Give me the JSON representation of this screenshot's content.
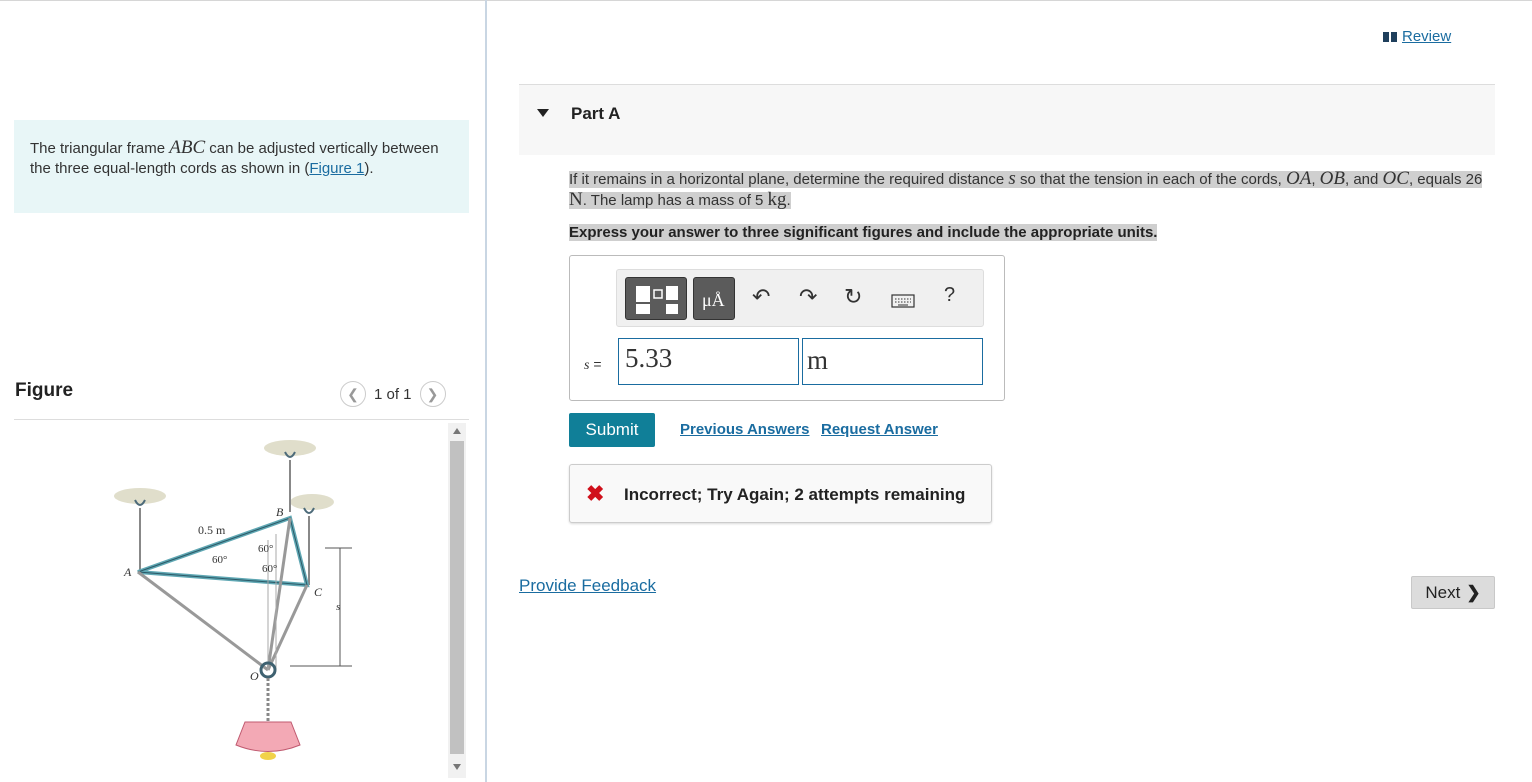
{
  "intro": {
    "text_before": "The triangular frame ",
    "math": "ABC",
    "text_after": " can be adjusted vertically between the three equal-length cords as shown in (",
    "link": "Figure 1",
    "close": ")."
  },
  "figure_panel": {
    "title": "Figure",
    "pager": "1 of 1",
    "labels": {
      "dist": "0.5 m",
      "angle1": "60°",
      "angle2": "60°",
      "angle3": "60°",
      "a": "A",
      "b": "B",
      "c": "C",
      "o": "O",
      "s": "s"
    }
  },
  "header": {
    "review": "Review"
  },
  "part": {
    "title": "Part A"
  },
  "question": {
    "t1": "If it remains in a horizontal plane, determine the required distance ",
    "s": "s",
    "t2": " so that the tension in each of the cords, ",
    "oa": "OA",
    "c1": ", ",
    "ob": "OB",
    "t3": ", and ",
    "oc": "OC",
    "t4": ", equals 26 ",
    "n": "N",
    "t5": ". The lamp has a mass of 5 ",
    "kg": "kg",
    "t6": "."
  },
  "instructions": "Express your answer to three significant figures and include the appropriate units.",
  "answer": {
    "variable": "s",
    "equals": " =",
    "value": "5.33",
    "unit": "m",
    "toolbar": {
      "units_button": "μÅ",
      "help": "?"
    }
  },
  "actions": {
    "submit": "Submit",
    "previous": "Previous Answers",
    "request": "Request Answer"
  },
  "feedback": {
    "message": "Incorrect; Try Again; 2 attempts remaining"
  },
  "footer": {
    "provide_feedback": "Provide Feedback",
    "next": "Next"
  }
}
